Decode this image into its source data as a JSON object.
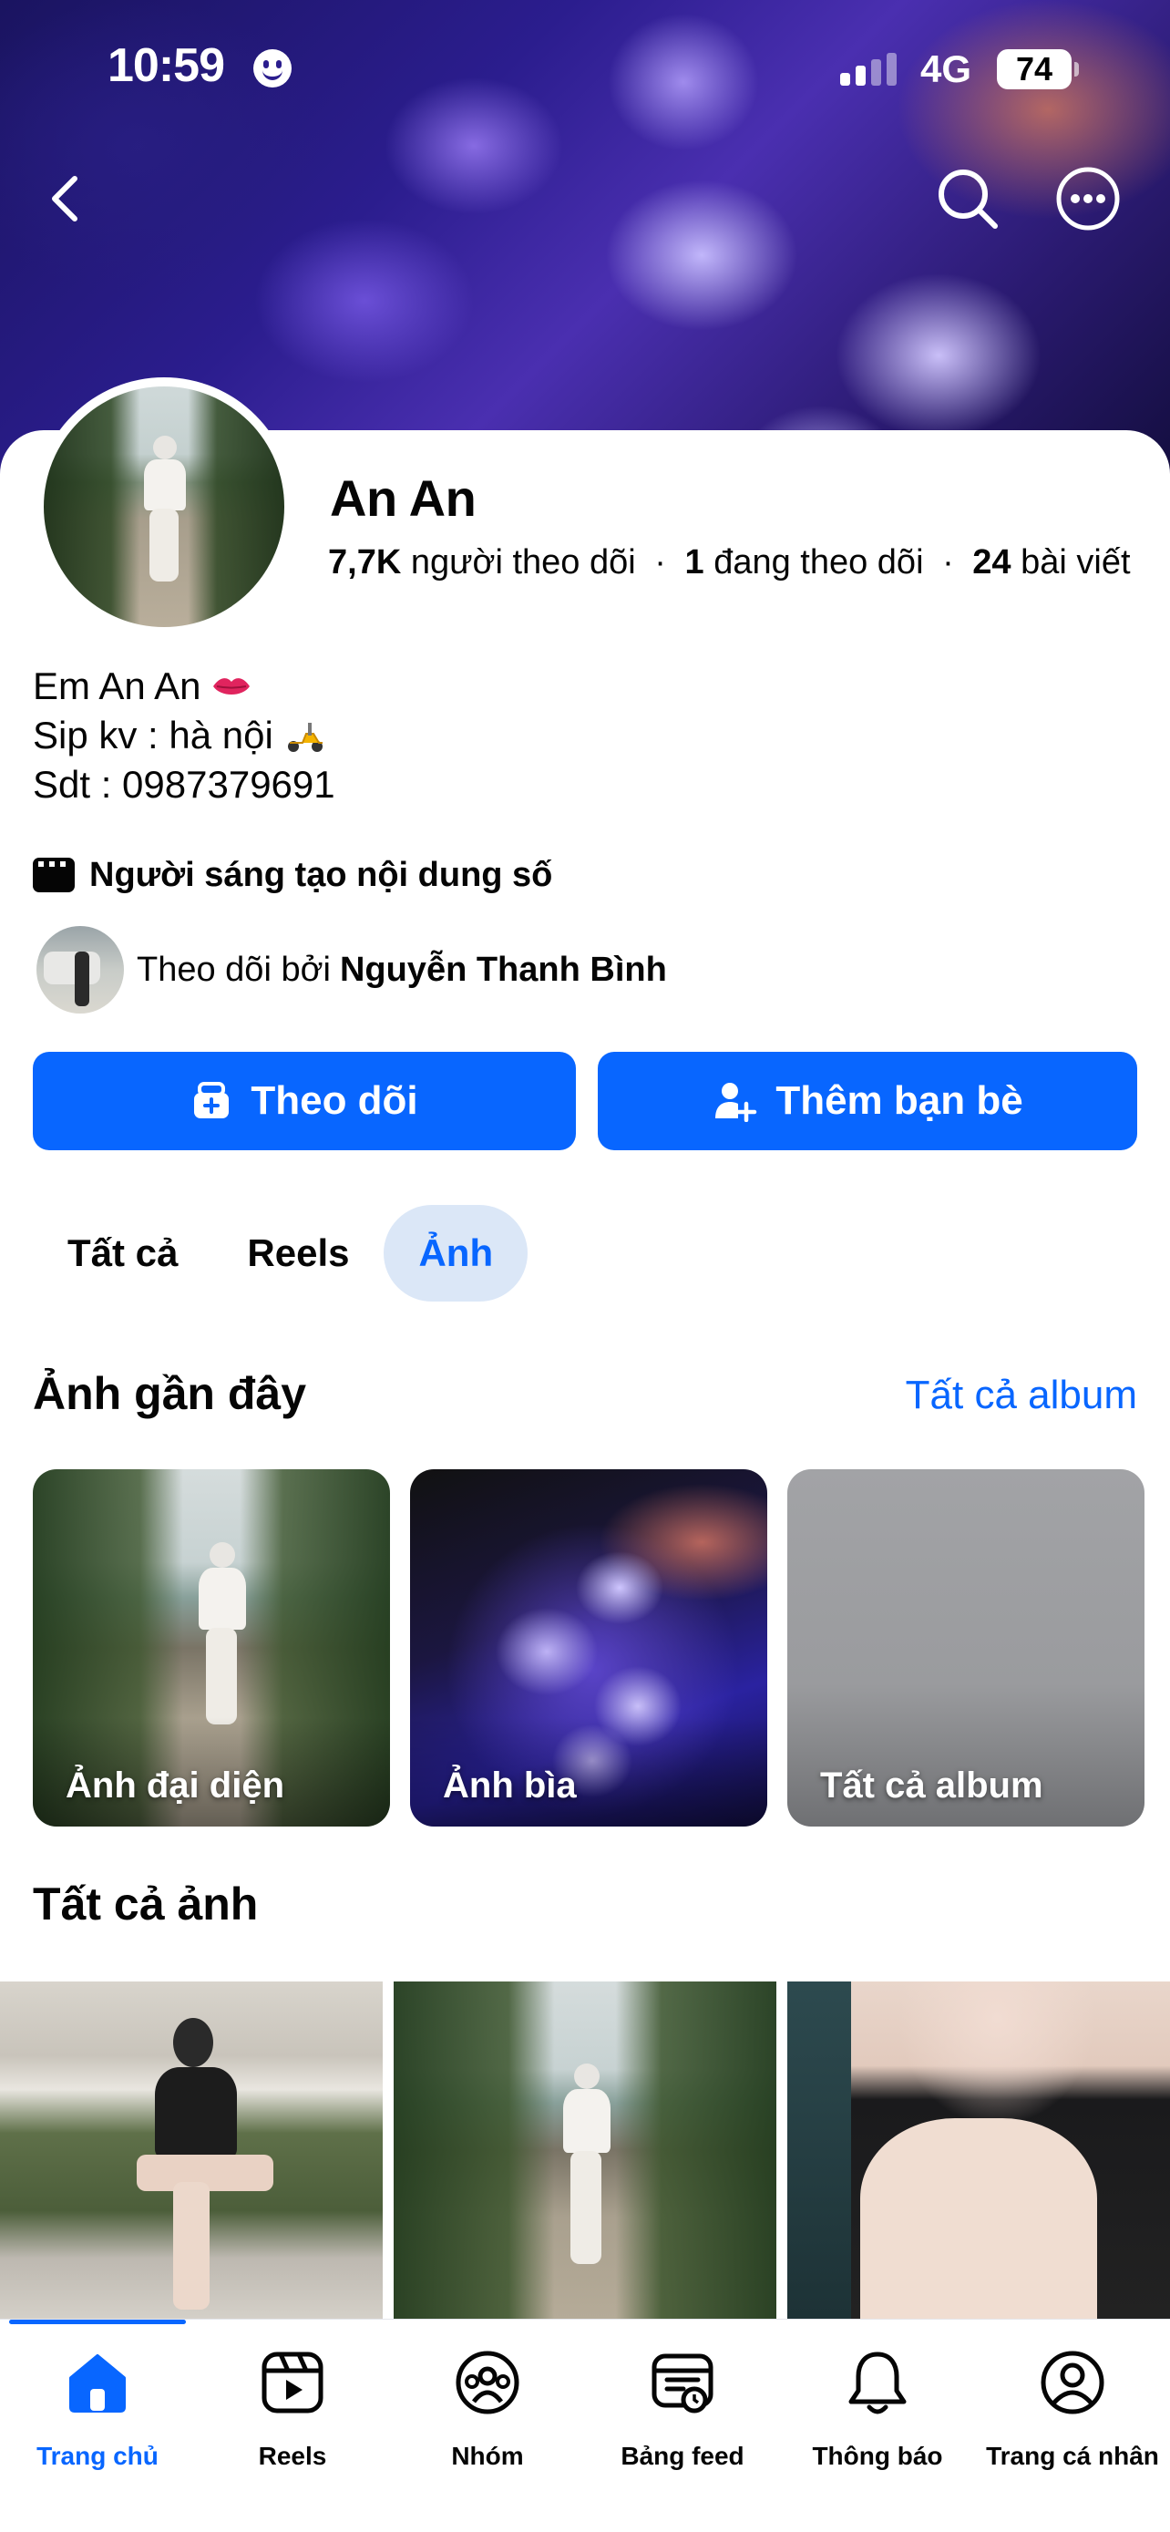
{
  "status_bar": {
    "time": "10:59",
    "network": "4G",
    "battery": "74"
  },
  "profile": {
    "name": "An An",
    "followers_count": "7,7K",
    "followers_label": "người theo dõi",
    "following_count": "1",
    "following_label": "đang theo dõi",
    "posts_count": "24",
    "posts_label": "bài viết",
    "bio_lines": [
      "Em An An",
      "Sip kv : hà nội",
      "Sdt : 0987379691"
    ],
    "category": "Người sáng tạo nội dung số",
    "followed_by_prefix": "Theo dõi bởi",
    "followed_by_name": "Nguyễn Thanh Bình"
  },
  "actions": {
    "follow_label": "Theo dõi",
    "add_friend_label": "Thêm bạn bè"
  },
  "tabs": [
    {
      "label": "Tất cả",
      "active": false
    },
    {
      "label": "Reels",
      "active": false
    },
    {
      "label": "Ảnh",
      "active": true
    }
  ],
  "recent_photos": {
    "title": "Ảnh gần đây",
    "link_label": "Tất cả album",
    "albums": [
      {
        "label": "Ảnh đại diện"
      },
      {
        "label": "Ảnh bìa"
      },
      {
        "label": "Tất cả album"
      }
    ]
  },
  "all_photos": {
    "title": "Tất cả ảnh"
  },
  "bottom_nav": [
    {
      "label": "Trang chủ",
      "icon": "home-icon",
      "active": true
    },
    {
      "label": "Reels",
      "icon": "reels-icon",
      "active": false
    },
    {
      "label": "Nhóm",
      "icon": "groups-icon",
      "active": false
    },
    {
      "label": "Bảng feed",
      "icon": "feed-icon",
      "active": false
    },
    {
      "label": "Thông báo",
      "icon": "bell-icon",
      "active": false
    },
    {
      "label": "Trang cá nhân",
      "icon": "profile-icon",
      "active": false
    }
  ],
  "colors": {
    "accent": "#0866ff",
    "active_tab_bg": "#dbe7f7",
    "text": "#050505"
  }
}
